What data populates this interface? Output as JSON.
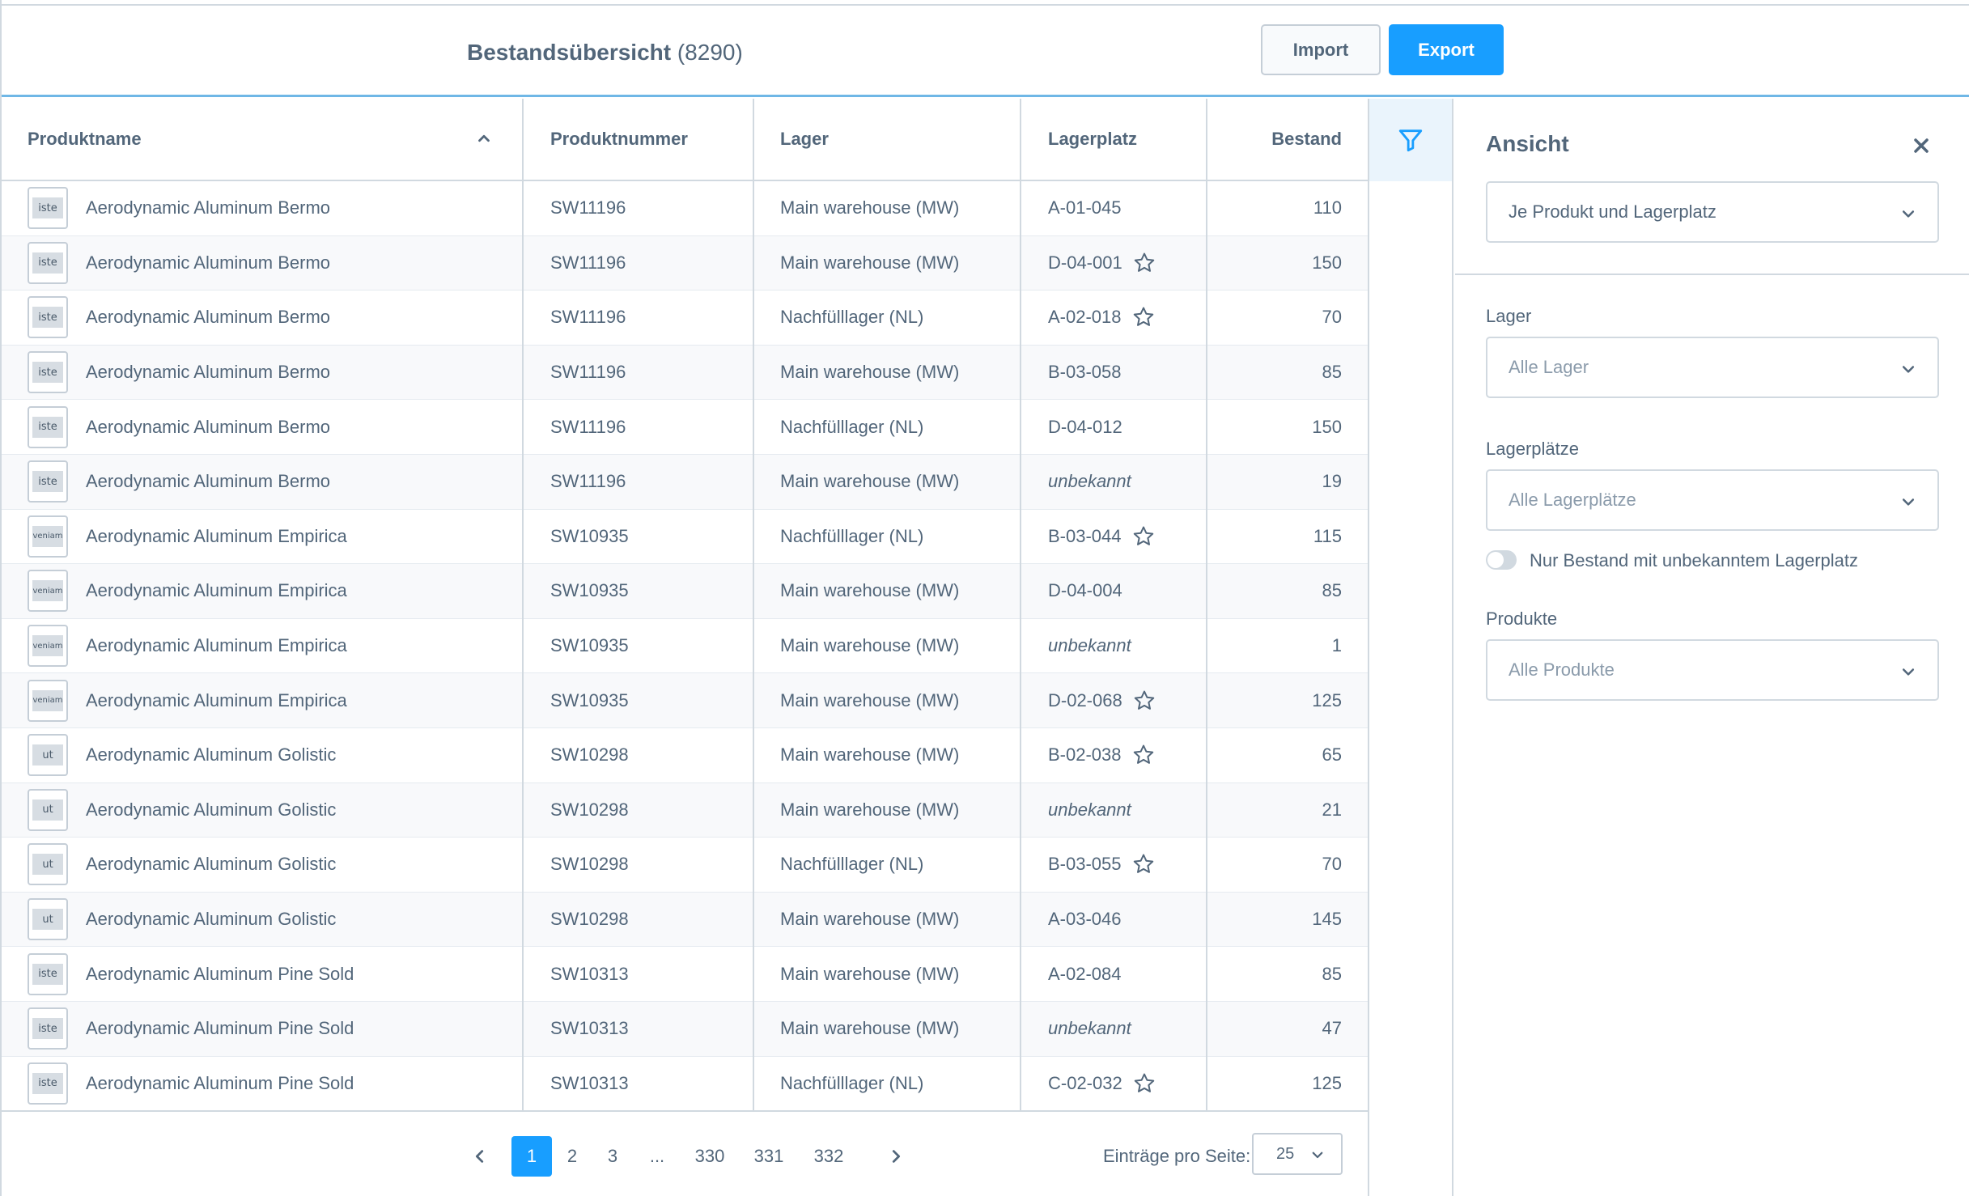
{
  "header": {
    "title": "Bestandsübersicht",
    "count": "(8290)",
    "import_label": "Import",
    "export_label": "Export"
  },
  "table": {
    "columns": [
      "Produktname",
      "Produktnummer",
      "Lager",
      "Lagerplatz",
      "Bestand"
    ],
    "rows": [
      {
        "thumb": "iste",
        "name": "Aerodynamic Aluminum Bermo",
        "number": "SW11196",
        "warehouse": "Main warehouse (MW)",
        "bin": "A-01-045",
        "unknown": false,
        "star": false,
        "stock": "110"
      },
      {
        "thumb": "iste",
        "name": "Aerodynamic Aluminum Bermo",
        "number": "SW11196",
        "warehouse": "Main warehouse (MW)",
        "bin": "D-04-001",
        "unknown": false,
        "star": true,
        "stock": "150"
      },
      {
        "thumb": "iste",
        "name": "Aerodynamic Aluminum Bermo",
        "number": "SW11196",
        "warehouse": "Nachfülllager (NL)",
        "bin": "A-02-018",
        "unknown": false,
        "star": true,
        "stock": "70"
      },
      {
        "thumb": "iste",
        "name": "Aerodynamic Aluminum Bermo",
        "number": "SW11196",
        "warehouse": "Main warehouse (MW)",
        "bin": "B-03-058",
        "unknown": false,
        "star": false,
        "stock": "85"
      },
      {
        "thumb": "iste",
        "name": "Aerodynamic Aluminum Bermo",
        "number": "SW11196",
        "warehouse": "Nachfülllager (NL)",
        "bin": "D-04-012",
        "unknown": false,
        "star": false,
        "stock": "150"
      },
      {
        "thumb": "iste",
        "name": "Aerodynamic Aluminum Bermo",
        "number": "SW11196",
        "warehouse": "Main warehouse (MW)",
        "bin": "unbekannt",
        "unknown": true,
        "star": false,
        "stock": "19"
      },
      {
        "thumb": "veniam",
        "name": "Aerodynamic Aluminum Empirica",
        "number": "SW10935",
        "warehouse": "Nachfülllager (NL)",
        "bin": "B-03-044",
        "unknown": false,
        "star": true,
        "stock": "115"
      },
      {
        "thumb": "veniam",
        "name": "Aerodynamic Aluminum Empirica",
        "number": "SW10935",
        "warehouse": "Main warehouse (MW)",
        "bin": "D-04-004",
        "unknown": false,
        "star": false,
        "stock": "85"
      },
      {
        "thumb": "veniam",
        "name": "Aerodynamic Aluminum Empirica",
        "number": "SW10935",
        "warehouse": "Main warehouse (MW)",
        "bin": "unbekannt",
        "unknown": true,
        "star": false,
        "stock": "1"
      },
      {
        "thumb": "veniam",
        "name": "Aerodynamic Aluminum Empirica",
        "number": "SW10935",
        "warehouse": "Main warehouse (MW)",
        "bin": "D-02-068",
        "unknown": false,
        "star": true,
        "stock": "125"
      },
      {
        "thumb": "ut",
        "name": "Aerodynamic Aluminum Golistic",
        "number": "SW10298",
        "warehouse": "Main warehouse (MW)",
        "bin": "B-02-038",
        "unknown": false,
        "star": true,
        "stock": "65"
      },
      {
        "thumb": "ut",
        "name": "Aerodynamic Aluminum Golistic",
        "number": "SW10298",
        "warehouse": "Main warehouse (MW)",
        "bin": "unbekannt",
        "unknown": true,
        "star": false,
        "stock": "21"
      },
      {
        "thumb": "ut",
        "name": "Aerodynamic Aluminum Golistic",
        "number": "SW10298",
        "warehouse": "Nachfülllager (NL)",
        "bin": "B-03-055",
        "unknown": false,
        "star": true,
        "stock": "70"
      },
      {
        "thumb": "ut",
        "name": "Aerodynamic Aluminum Golistic",
        "number": "SW10298",
        "warehouse": "Main warehouse (MW)",
        "bin": "A-03-046",
        "unknown": false,
        "star": false,
        "stock": "145"
      },
      {
        "thumb": "iste",
        "name": "Aerodynamic Aluminum Pine Sold",
        "number": "SW10313",
        "warehouse": "Main warehouse (MW)",
        "bin": "A-02-084",
        "unknown": false,
        "star": false,
        "stock": "85"
      },
      {
        "thumb": "iste",
        "name": "Aerodynamic Aluminum Pine Sold",
        "number": "SW10313",
        "warehouse": "Main warehouse (MW)",
        "bin": "unbekannt",
        "unknown": true,
        "star": false,
        "stock": "47"
      },
      {
        "thumb": "iste",
        "name": "Aerodynamic Aluminum Pine Sold",
        "number": "SW10313",
        "warehouse": "Nachfülllager (NL)",
        "bin": "C-02-032",
        "unknown": false,
        "star": true,
        "stock": "125"
      }
    ]
  },
  "pagination": {
    "pages": [
      "1",
      "2",
      "3",
      "...",
      "330",
      "331",
      "332"
    ],
    "active": "1",
    "per_page_label": "Einträge pro Seite:",
    "per_page_value": "25"
  },
  "panel": {
    "title": "Ansicht",
    "view_value": "Je Produkt und Lagerplatz",
    "warehouse_label": "Lager",
    "warehouse_placeholder": "Alle Lager",
    "bins_label": "Lagerplätze",
    "bins_placeholder": "Alle Lagerplätze",
    "toggle_label": "Nur Bestand mit unbekanntem Lagerplatz",
    "products_label": "Produkte",
    "products_placeholder": "Alle Produkte"
  },
  "colors": {
    "primary": "#189eff",
    "text": "#52667a",
    "border": "#d1d9e0",
    "row_alt": "#f8f9fb",
    "accent_line": "#6fb7e6"
  },
  "icons": {
    "sort": "chevron-up-icon",
    "star": "star-outline-icon",
    "filter": "funnel-icon",
    "close": "close-icon",
    "dropdown": "chevron-down-icon",
    "prev": "chevron-left-icon",
    "next": "chevron-right-icon"
  }
}
